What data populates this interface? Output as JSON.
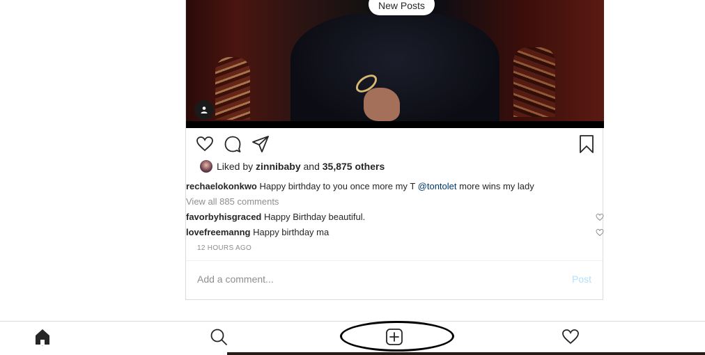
{
  "post": {
    "new_posts_label": "New Posts",
    "likes": {
      "prefix": "Liked by",
      "user": "zinnibaby",
      "conjunction": "and",
      "others": "35,875 others"
    },
    "caption": {
      "user": "rechaelokonkwo",
      "text": "Happy birthday to you once more my T",
      "mention": "@tontolet",
      "text_after": "more wins my lady"
    },
    "view_all_comments": "View all 885 comments",
    "comments": [
      {
        "user": "favorbyhisgraced",
        "text": "Happy Birthday beautiful."
      },
      {
        "user": "lovefreemanng",
        "text": "Happy birthday ma"
      }
    ],
    "timestamp": "12 HOURS AGO",
    "comment_placeholder": "Add a comment...",
    "post_button": "Post"
  },
  "icons": {
    "like": "heart-icon",
    "comment": "comment-icon",
    "share": "paper-plane-icon",
    "save": "bookmark-icon",
    "home": "home-icon",
    "search": "search-icon",
    "new_post": "plus-square-icon",
    "activity": "heart-icon"
  }
}
